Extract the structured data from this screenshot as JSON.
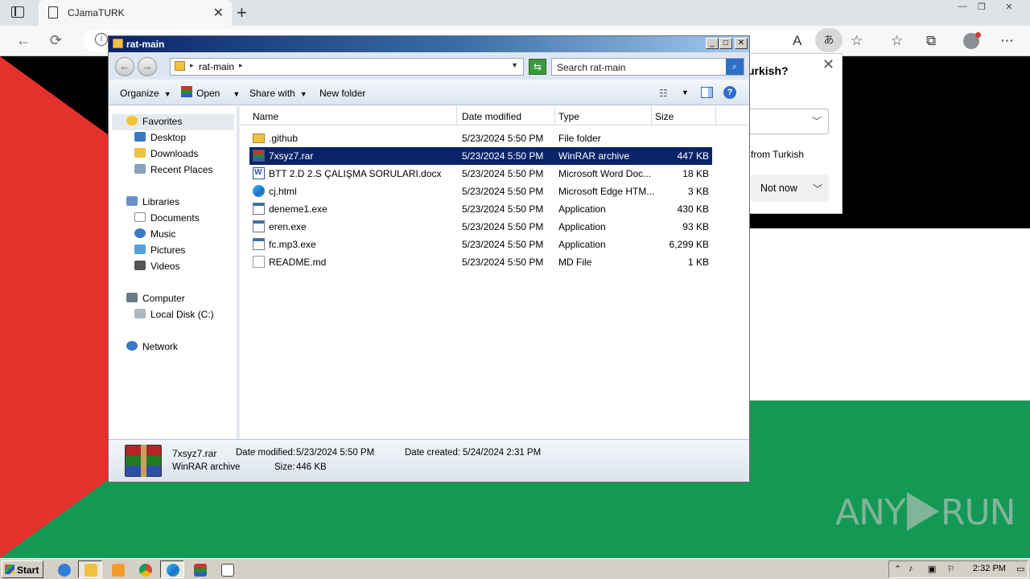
{
  "browser": {
    "tab_title": "CJamaTURK",
    "tab_close": "✕",
    "new_tab": "+",
    "aa_label": "あ",
    "read_aloud": "A",
    "window_min": "—",
    "window_restore": "❐",
    "window_close": "✕"
  },
  "translate_popup": {
    "question": "urkish?",
    "from_text": "from Turkish",
    "not_now": "Not now",
    "close": "✕"
  },
  "explorer": {
    "title": "rat-main",
    "breadcrumb": "rat-main",
    "search_placeholder": "Search rat-main",
    "toolbar": {
      "organize": "Organize",
      "open": "Open",
      "share_with": "Share with",
      "new_folder": "New folder"
    },
    "nav": {
      "favorites": "Favorites",
      "desktop": "Desktop",
      "downloads": "Downloads",
      "recent_places": "Recent Places",
      "libraries": "Libraries",
      "documents": "Documents",
      "music": "Music",
      "pictures": "Pictures",
      "videos": "Videos",
      "computer": "Computer",
      "local_disk": "Local Disk (C:)",
      "network": "Network"
    },
    "columns": {
      "name": "Name",
      "date_modified": "Date modified",
      "type": "Type",
      "size": "Size"
    },
    "files": [
      {
        "name": ".github",
        "date": "5/23/2024 5:50 PM",
        "type": "File folder",
        "size": "",
        "icon": "folder"
      },
      {
        "name": "7xsyz7.rar",
        "date": "5/23/2024 5:50 PM",
        "type": "WinRAR archive",
        "size": "447 KB",
        "icon": "rar"
      },
      {
        "name": "BTT 2.D 2.S ÇALIŞMA SORULARI.docx",
        "date": "5/23/2024 5:50 PM",
        "type": "Microsoft Word Doc...",
        "size": "18 KB",
        "icon": "doc"
      },
      {
        "name": "cj.html",
        "date": "5/23/2024 5:50 PM",
        "type": "Microsoft Edge HTM...",
        "size": "3 KB",
        "icon": "edge"
      },
      {
        "name": "deneme1.exe",
        "date": "5/23/2024 5:50 PM",
        "type": "Application",
        "size": "430 KB",
        "icon": "exe"
      },
      {
        "name": "eren.exe",
        "date": "5/23/2024 5:50 PM",
        "type": "Application",
        "size": "93 KB",
        "icon": "exe"
      },
      {
        "name": "fc.mp3.exe",
        "date": "5/23/2024 5:50 PM",
        "type": "Application",
        "size": "6,299 KB",
        "icon": "exe"
      },
      {
        "name": "README.md",
        "date": "5/23/2024 5:50 PM",
        "type": "MD File",
        "size": "1 KB",
        "icon": "md"
      }
    ],
    "details": {
      "filename": "7xsyz7.rar",
      "filetype": "WinRAR archive",
      "date_modified_label": "Date modified:",
      "date_modified": "5/23/2024 5:50 PM",
      "date_created_label": "Date created:",
      "date_created": "5/24/2024 2:31 PM",
      "size_label": "Size:",
      "size": "446 KB"
    }
  },
  "watermark": {
    "left": "ANY",
    "right": "RUN"
  },
  "taskbar": {
    "start": "Start",
    "clock": "2:32 PM"
  },
  "colors": {
    "flag_red": "#e4312b",
    "flag_green": "#149954",
    "selection": "#0a246a"
  }
}
